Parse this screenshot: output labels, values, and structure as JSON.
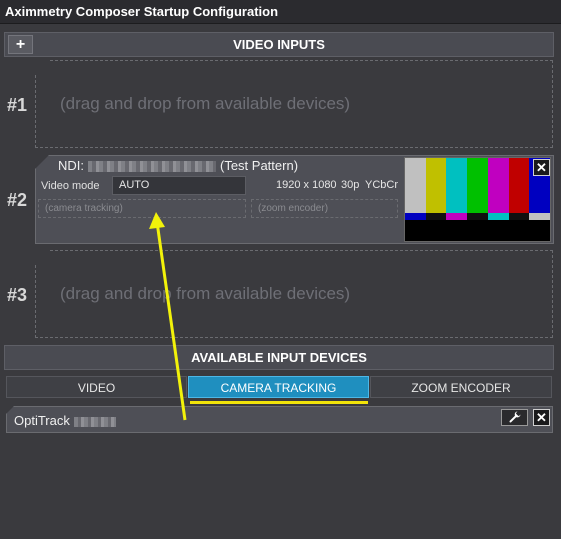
{
  "window": {
    "title": "Aximmetry Composer Startup Configuration"
  },
  "video_inputs": {
    "header": "VIDEO INPUTS",
    "add_button": "+",
    "slots": [
      {
        "label": "#1",
        "placeholder": "(drag and drop from available devices)"
      },
      {
        "label": "#2"
      },
      {
        "label": "#3",
        "placeholder": "(drag and drop from available devices)"
      }
    ],
    "device": {
      "name_prefix": "NDI:",
      "name_suffix": "(Test Pattern)",
      "video_mode_label": "Video mode",
      "video_mode_value": "AUTO",
      "resolution": "1920 x 1080",
      "framerate": "30p",
      "color_format": "YCbCr",
      "camera_tracking_placeholder": "(camera tracking)",
      "zoom_encoder_placeholder": "(zoom encoder)",
      "close_symbol": "✕"
    }
  },
  "available_devices": {
    "header": "AVAILABLE INPUT DEVICES",
    "tabs": [
      "VIDEO",
      "CAMERA TRACKING",
      "ZOOM ENCODER"
    ],
    "active_tab": "CAMERA TRACKING",
    "items": [
      {
        "name": "OptiTrack",
        "wrench_icon": "wrench-icon",
        "close_symbol": "✕"
      }
    ]
  },
  "colors": {
    "active_tab": "#1f8fbf",
    "underline": "#f2e40a",
    "annotation_arrow": "#f2f20a",
    "color_bars": [
      "#c0c0c0",
      "#c0c000",
      "#00c0c0",
      "#00c000",
      "#c000c0",
      "#c00000",
      "#0000c0"
    ],
    "sub_bars": [
      "#0000c0",
      "#101010",
      "#c000c0",
      "#101010",
      "#00c0c0",
      "#101010",
      "#c0c0c0"
    ]
  }
}
